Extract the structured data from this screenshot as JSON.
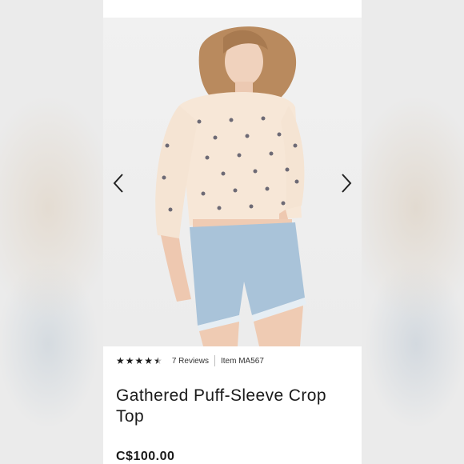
{
  "product": {
    "rating": {
      "stars_filled": 4.5,
      "stars_total": 5
    },
    "reviews_label": "7 Reviews",
    "item_number": "Item MA567",
    "title": "Gathered Puff-Sleeve Crop Top",
    "price": "C$100.00"
  },
  "gallery": {
    "prev_icon": "chevron-left-icon",
    "next_icon": "chevron-right-icon"
  }
}
